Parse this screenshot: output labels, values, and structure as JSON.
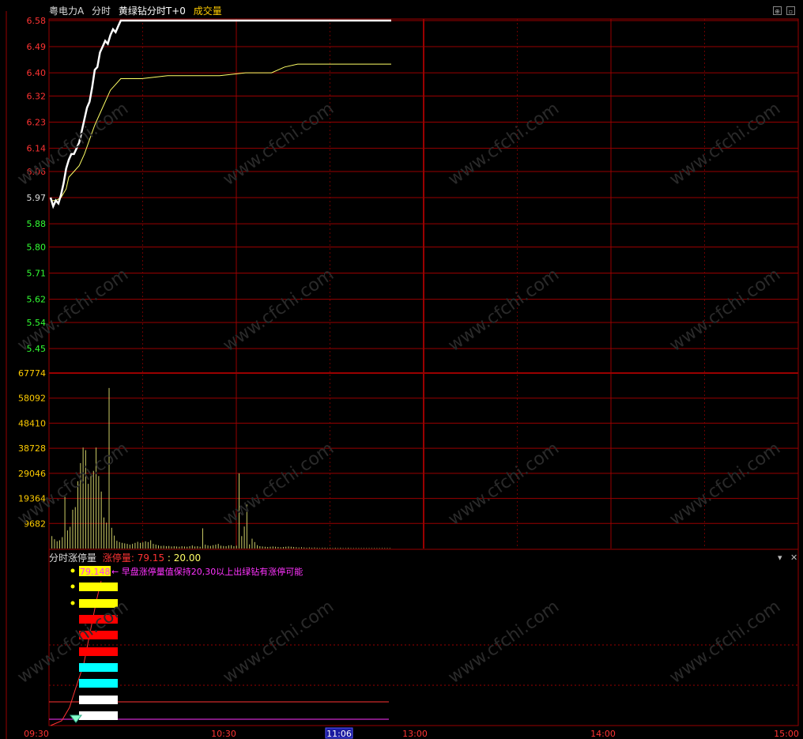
{
  "header": {
    "stock_name": "粤电力A",
    "period": "分时",
    "indicator_name": "黄绿钻分时T+0",
    "volume_label": "成交量"
  },
  "sub_panel": {
    "title": "分时涨停量",
    "value_label": "涨停量:",
    "value": "79.15",
    "threshold": ": 20.00",
    "signal_value": "79.148",
    "annotation": "早盘涨停量值保持20,30以上出绿钻有涨停可能"
  },
  "watermark": "www.cfchi.com",
  "colors": {
    "price_up": "#ff3333",
    "price_down": "#33ff33",
    "grid": "#990000",
    "price_line": "#ffffff",
    "avg_line": "#ffff66",
    "volume": "#cccc66",
    "magenta": "#ff33ff"
  },
  "chart_data": [
    {
      "type": "line",
      "y_ticks": [
        "6.58",
        "6.49",
        "6.40",
        "6.32",
        "6.23",
        "6.14",
        "6.06",
        "5.97",
        "5.88",
        "5.80",
        "5.71",
        "5.62",
        "5.54",
        "5.45"
      ],
      "ylim": [
        5.45,
        6.58
      ],
      "reference_price": 5.97,
      "series": [
        {
          "values": [
            [
              0,
              5.97
            ],
            [
              2,
              5.94
            ],
            [
              4,
              5.96
            ],
            [
              6,
              5.95
            ],
            [
              8,
              5.98
            ],
            [
              10,
              6.02
            ],
            [
              12,
              6.07
            ],
            [
              14,
              6.1
            ],
            [
              16,
              6.12
            ],
            [
              18,
              6.12
            ],
            [
              20,
              6.14
            ],
            [
              22,
              6.16
            ],
            [
              24,
              6.2
            ],
            [
              26,
              6.24
            ],
            [
              28,
              6.28
            ],
            [
              30,
              6.3
            ],
            [
              32,
              6.35
            ],
            [
              34,
              6.41
            ],
            [
              36,
              6.42
            ],
            [
              38,
              6.47
            ],
            [
              40,
              6.49
            ],
            [
              42,
              6.51
            ],
            [
              44,
              6.5
            ],
            [
              46,
              6.53
            ],
            [
              48,
              6.55
            ],
            [
              50,
              6.54
            ],
            [
              52,
              6.56
            ],
            [
              54,
              6.58
            ],
            [
              60,
              6.58
            ],
            [
              90,
              6.58
            ],
            [
              120,
              6.58
            ],
            [
              150,
              6.58
            ],
            [
              180,
              6.58
            ],
            [
              210,
              6.58
            ],
            [
              240,
              6.58
            ],
            [
              262,
              6.58
            ]
          ]
        },
        {
          "values": [
            [
              0,
              5.96
            ],
            [
              4,
              5.96
            ],
            [
              8,
              5.97
            ],
            [
              12,
              6.0
            ],
            [
              14,
              6.04
            ],
            [
              18,
              6.06
            ],
            [
              22,
              6.08
            ],
            [
              26,
              6.12
            ],
            [
              30,
              6.17
            ],
            [
              34,
              6.22
            ],
            [
              38,
              6.26
            ],
            [
              42,
              6.3
            ],
            [
              46,
              6.34
            ],
            [
              50,
              6.36
            ],
            [
              54,
              6.38
            ],
            [
              58,
              6.38
            ],
            [
              70,
              6.38
            ],
            [
              90,
              6.39
            ],
            [
              110,
              6.39
            ],
            [
              130,
              6.39
            ],
            [
              150,
              6.4
            ],
            [
              170,
              6.4
            ],
            [
              175,
              6.41
            ],
            [
              180,
              6.42
            ],
            [
              190,
              6.43
            ],
            [
              210,
              6.43
            ],
            [
              240,
              6.43
            ],
            [
              262,
              6.43
            ]
          ]
        }
      ],
      "session_times": [
        "09:30",
        "10:30",
        "11:06",
        "13:00",
        "14:00",
        "15:00"
      ]
    },
    {
      "type": "bar",
      "y_ticks": [
        "67774",
        "58092",
        "48410",
        "38728",
        "29046",
        "19364",
        "9682"
      ],
      "ylim": [
        0,
        67774
      ],
      "values": [
        [
          1,
          4800
        ],
        [
          3,
          3600
        ],
        [
          5,
          2800
        ],
        [
          7,
          3200
        ],
        [
          9,
          4400
        ],
        [
          11,
          20000
        ],
        [
          13,
          7000
        ],
        [
          15,
          8400
        ],
        [
          17,
          15000
        ],
        [
          19,
          16000
        ],
        [
          21,
          26000
        ],
        [
          23,
          33000
        ],
        [
          25,
          39000
        ],
        [
          27,
          38000
        ],
        [
          29,
          25000
        ],
        [
          31,
          28000
        ],
        [
          33,
          30000
        ],
        [
          35,
          39000
        ],
        [
          37,
          28000
        ],
        [
          39,
          22000
        ],
        [
          41,
          12000
        ],
        [
          43,
          10000
        ],
        [
          45,
          62000
        ],
        [
          47,
          8000
        ],
        [
          49,
          5000
        ],
        [
          51,
          3000
        ],
        [
          53,
          2500
        ],
        [
          55,
          2200
        ],
        [
          57,
          2000
        ],
        [
          59,
          1800
        ],
        [
          61,
          1500
        ],
        [
          63,
          1800
        ],
        [
          65,
          2200
        ],
        [
          67,
          2600
        ],
        [
          69,
          2200
        ],
        [
          71,
          2400
        ],
        [
          73,
          2800
        ],
        [
          75,
          2500
        ],
        [
          77,
          3200
        ],
        [
          79,
          1800
        ],
        [
          81,
          1500
        ],
        [
          83,
          1200
        ],
        [
          85,
          1000
        ],
        [
          87,
          1100
        ],
        [
          89,
          900
        ],
        [
          91,
          1000
        ],
        [
          93,
          800
        ],
        [
          95,
          900
        ],
        [
          97,
          800
        ],
        [
          99,
          700
        ],
        [
          101,
          900
        ],
        [
          103,
          800
        ],
        [
          105,
          700
        ],
        [
          107,
          900
        ],
        [
          109,
          1200
        ],
        [
          111,
          800
        ],
        [
          113,
          900
        ],
        [
          115,
          700
        ],
        [
          117,
          7800
        ],
        [
          119,
          1500
        ],
        [
          121,
          1200
        ],
        [
          123,
          1000
        ],
        [
          125,
          1300
        ],
        [
          127,
          1500
        ],
        [
          129,
          1800
        ],
        [
          131,
          1100
        ],
        [
          133,
          1000
        ],
        [
          135,
          900
        ],
        [
          137,
          1200
        ],
        [
          139,
          1300
        ],
        [
          141,
          900
        ],
        [
          143,
          1100
        ],
        [
          145,
          29000
        ],
        [
          147,
          4800
        ],
        [
          149,
          8500
        ],
        [
          151,
          17000
        ],
        [
          153,
          1600
        ],
        [
          155,
          3800
        ],
        [
          157,
          2500
        ],
        [
          159,
          1300
        ],
        [
          161,
          900
        ],
        [
          163,
          800
        ],
        [
          165,
          700
        ],
        [
          167,
          600
        ],
        [
          169,
          700
        ],
        [
          171,
          800
        ],
        [
          173,
          700
        ],
        [
          175,
          600
        ],
        [
          177,
          500
        ],
        [
          179,
          600
        ],
        [
          181,
          700
        ],
        [
          183,
          800
        ],
        [
          185,
          700
        ],
        [
          187,
          600
        ],
        [
          189,
          500
        ],
        [
          191,
          400
        ],
        [
          193,
          500
        ],
        [
          195,
          400
        ],
        [
          197,
          300
        ],
        [
          199,
          400
        ],
        [
          201,
          300
        ],
        [
          203,
          400
        ],
        [
          205,
          300
        ],
        [
          207,
          200
        ],
        [
          209,
          300
        ],
        [
          211,
          300
        ],
        [
          213,
          200
        ],
        [
          215,
          300
        ],
        [
          217,
          200
        ],
        [
          219,
          300
        ],
        [
          221,
          200
        ],
        [
          223,
          300
        ],
        [
          225,
          200
        ],
        [
          227,
          200
        ],
        [
          229,
          300
        ],
        [
          231,
          200
        ],
        [
          233,
          200
        ],
        [
          235,
          200
        ],
        [
          237,
          200
        ],
        [
          239,
          200
        ],
        [
          241,
          200
        ],
        [
          243,
          200
        ],
        [
          245,
          200
        ],
        [
          247,
          200
        ],
        [
          249,
          200
        ],
        [
          251,
          200
        ],
        [
          253,
          200
        ],
        [
          255,
          200
        ],
        [
          257,
          200
        ],
        [
          259,
          200
        ],
        [
          261,
          200
        ]
      ]
    }
  ]
}
